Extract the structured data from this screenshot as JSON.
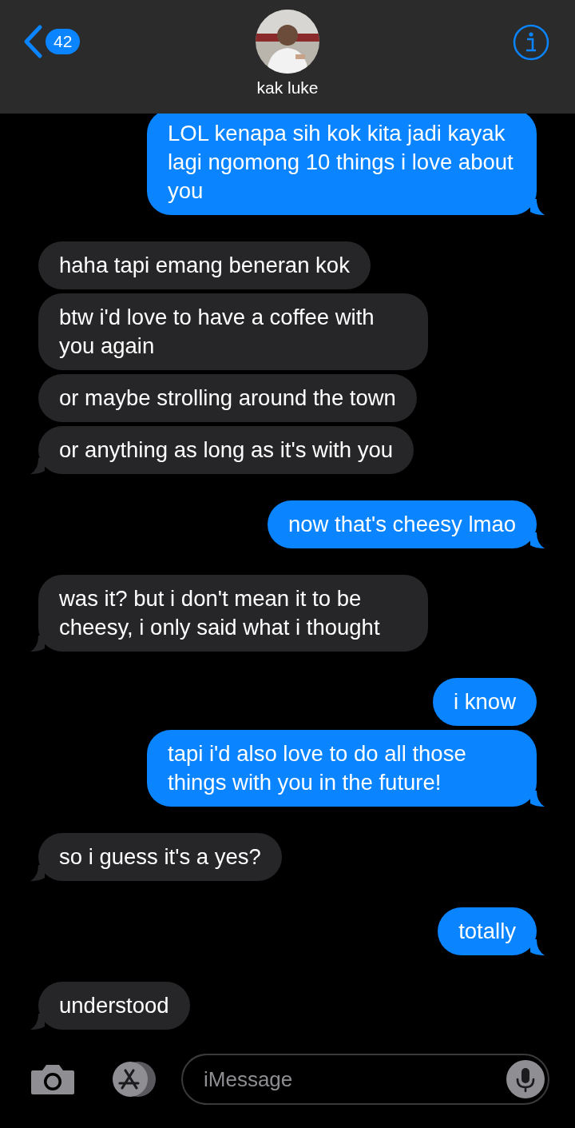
{
  "header": {
    "back_badge": "42",
    "contact_name": "kak luke"
  },
  "groups": [
    {
      "kind": "sent",
      "messages": [
        "LOL kenapa sih kok kita jadi kayak lagi ngomong 10 things i love about you"
      ]
    },
    {
      "kind": "received",
      "messages": [
        "haha tapi emang beneran kok",
        "btw i'd love to have a coffee with you again",
        "or maybe strolling around the town",
        "or anything as long as it's with you"
      ]
    },
    {
      "kind": "sent",
      "messages": [
        "now that's cheesy lmao"
      ]
    },
    {
      "kind": "received",
      "messages": [
        "was it? but i don't mean it to be cheesy, i only said what i thought"
      ]
    },
    {
      "kind": "sent",
      "messages": [
        "i know",
        "tapi i'd also love to do all those things with you in the future!"
      ]
    },
    {
      "kind": "received",
      "messages": [
        "so i guess it's a yes?"
      ]
    },
    {
      "kind": "sent",
      "messages": [
        "totally"
      ]
    },
    {
      "kind": "received",
      "messages": [
        "understood"
      ]
    }
  ],
  "composer": {
    "placeholder": "iMessage"
  }
}
